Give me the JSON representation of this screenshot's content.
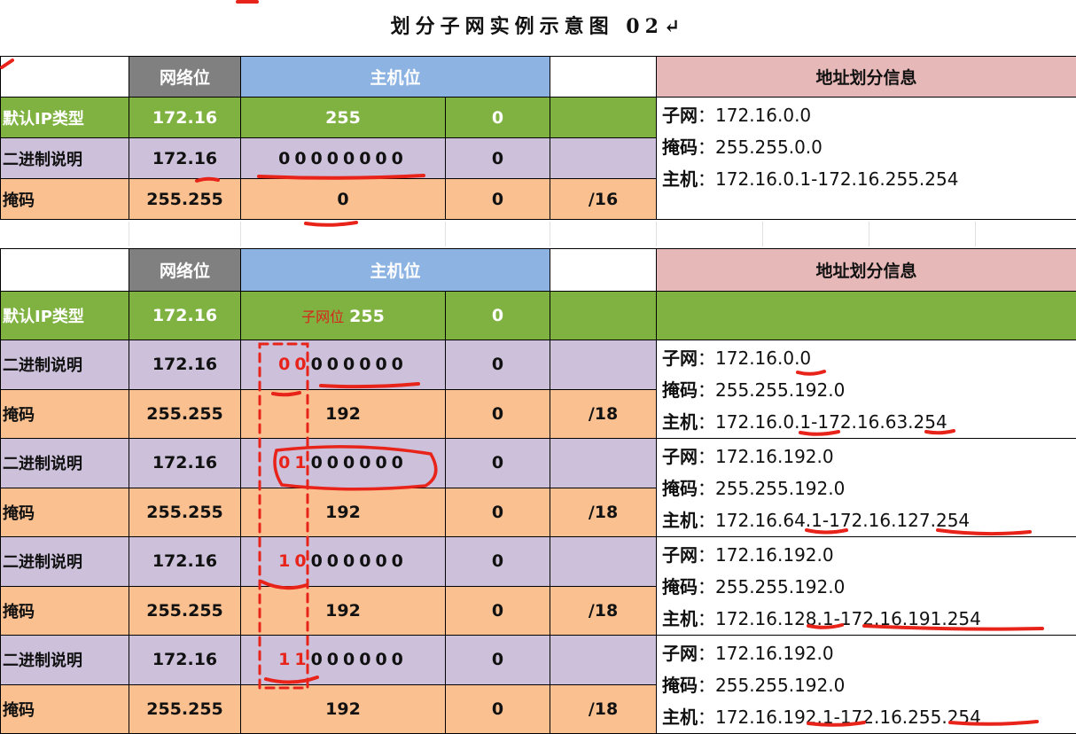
{
  "title": "划分子网实例示意图 02↵",
  "header": {
    "network": "网络位",
    "host": "主机位",
    "info": "地址划分信息",
    "subnet_bits_tag": "子网位"
  },
  "labels": {
    "default": "默认IP类型",
    "binary": "二进制说明",
    "mask": "掩码"
  },
  "upper": {
    "default_row": [
      "172.16",
      "255",
      "0"
    ],
    "binary_row": [
      "172.16",
      "00000000",
      "0"
    ],
    "mask_row": [
      "255.255",
      "0",
      "0",
      "/16"
    ],
    "info": [
      {
        "key": "子网",
        "value": "：172.16.0.0"
      },
      {
        "key": "掩码",
        "value": "：255.255.0.0"
      },
      {
        "key": "主机",
        "value": "：172.16.0.1-172.16.255.254"
      }
    ]
  },
  "lower": {
    "default_row": [
      "172.16",
      "255",
      "0"
    ],
    "groups": [
      {
        "binary": [
          "172.16",
          "00",
          "000000",
          "0"
        ],
        "mask": [
          "255.255",
          "192",
          "0",
          "/18"
        ],
        "info": [
          {
            "key": "子网",
            "value": "：172.16.0.0"
          },
          {
            "key": "掩码",
            "value": "：255.255.192.0"
          },
          {
            "key": "主机",
            "value": "：172.16.0.1-172.16.63.254"
          }
        ]
      },
      {
        "binary": [
          "172.16",
          "01",
          "000000",
          "0"
        ],
        "mask": [
          "255.255",
          "192",
          "0",
          "/18"
        ],
        "info": [
          {
            "key": "子网",
            "value": "：172.16.192.0"
          },
          {
            "key": "掩码",
            "value": "：255.255.192.0"
          },
          {
            "key": "主机",
            "value": "：172.16.64.1-172.16.127.254"
          }
        ]
      },
      {
        "binary": [
          "172.16",
          "10",
          "000000",
          "0"
        ],
        "mask": [
          "255.255",
          "192",
          "0",
          "/18"
        ],
        "info": [
          {
            "key": "子网",
            "value": "：172.16.192.0"
          },
          {
            "key": "掩码",
            "value": "：255.255.192.0"
          },
          {
            "key": "主机",
            "value": "：172.16.128.1-172.16.191.254"
          }
        ]
      },
      {
        "binary": [
          "172.16",
          "11",
          "000000",
          "0"
        ],
        "mask": [
          "255.255",
          "192",
          "0",
          "/18"
        ],
        "info": [
          {
            "key": "子网",
            "value": "：172.16.192.0"
          },
          {
            "key": "掩码",
            "value": "：255.255.192.0"
          },
          {
            "key": "主机",
            "value": "：172.16.192.1-172.16.255.254"
          }
        ]
      }
    ]
  },
  "colors": {
    "network_header": "#808080",
    "host_header": "#8db3e2",
    "info_header": "#e6b8b7",
    "default_row": "#7fb241",
    "binary_row": "#ccc0da",
    "mask_row": "#fac090",
    "annotation": "#e8231a"
  }
}
